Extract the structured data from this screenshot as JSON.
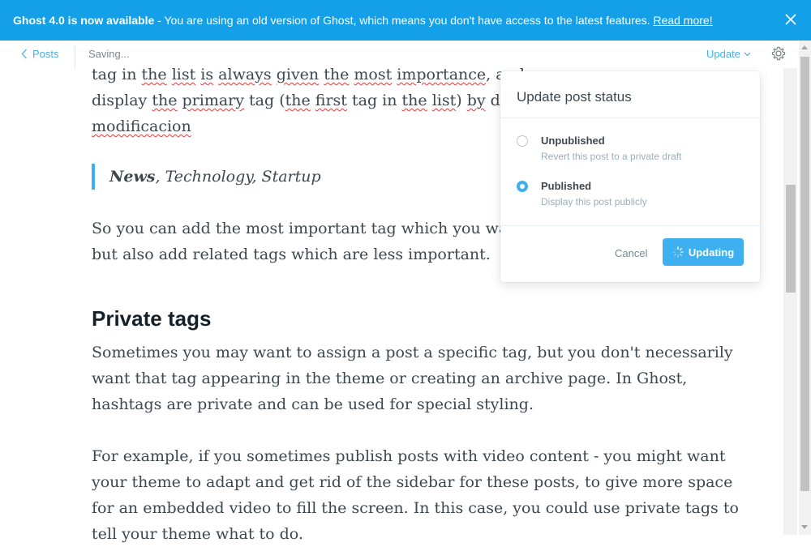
{
  "banner": {
    "title": "Ghost 4.0 is now available",
    "message": " - You are using an old version of Ghost, which means you don't have access to the latest features. ",
    "link": "Read more!"
  },
  "topbar": {
    "back_label": "Posts",
    "status": "Saving...",
    "update_label": "Update"
  },
  "editor": {
    "line1": [
      "tag in ",
      "the",
      " ",
      "list",
      " ",
      "is",
      " ",
      "always",
      " ",
      "given",
      " ",
      "the",
      " ",
      "most",
      " ",
      "importance",
      ", and so"
    ],
    "line2": [
      "display ",
      "the",
      " ",
      "primary",
      " tag (",
      "the",
      " ",
      "first",
      " tag in ",
      "the",
      " ",
      "list",
      ") ",
      "by",
      " default"
    ],
    "line3": "modificacion",
    "quote_bold": "News",
    "quote_rest": ", Technology, Startup",
    "para1": [
      "So you can add the most important tag which you want to",
      "but also add related tags which are less important."
    ],
    "heading": "Private tags",
    "para2": [
      "Sometimes you may want to assign a post a specific tag, but you don't necessarily",
      "want that tag appearing in the theme or creating an archive page. In Ghost,",
      "hashtags are private and can be used for special styling."
    ],
    "para3": [
      "For example, if you sometimes publish posts with video content - you might want",
      "your theme to adapt and get rid of the sidebar for these posts, to give more space",
      "for an embedded video to fill the screen. In this case, you could use private tags to",
      "tell your theme what to do."
    ]
  },
  "popover": {
    "title": "Update post status",
    "options": [
      {
        "label": "Unpublished",
        "desc": "Revert this post to a private draft",
        "selected": false
      },
      {
        "label": "Published",
        "desc": "Display this post publicly",
        "selected": true
      }
    ],
    "cancel": "Cancel",
    "confirm": "Updating"
  },
  "colors": {
    "accent": "#3eb0ef",
    "banner": "#14a0e9",
    "spell_error": "#e03b3b"
  },
  "icons": [
    "close-icon",
    "chevron-left-icon",
    "chevron-down-icon",
    "gear-icon",
    "spinner-icon"
  ]
}
